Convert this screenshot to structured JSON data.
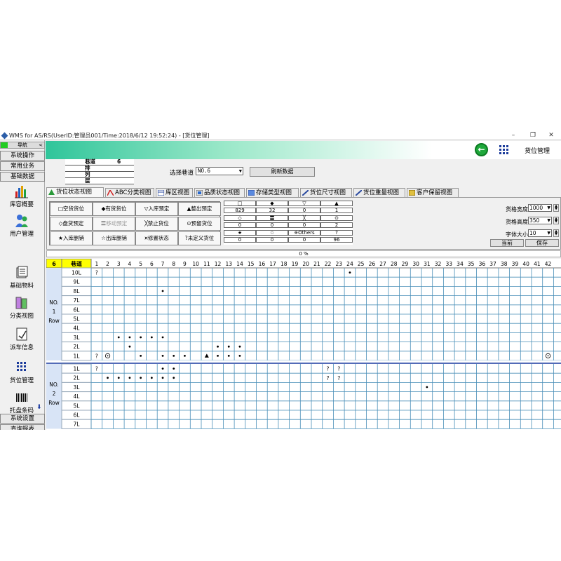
{
  "window": {
    "title": "WMS for AS/RS(UserID:管理员001/Time:2018/6/12 19:52:24) - [货位管理]",
    "min_label": "–",
    "max_label": "❐",
    "close_label": "✕"
  },
  "nav": {
    "header": "导航",
    "collapse": "<",
    "top_buttons": [
      "系统操作",
      "常用业务",
      "基础数据"
    ],
    "items": [
      {
        "label": "库容概要",
        "icon": "bar-chart-icon"
      },
      {
        "label": "用户管理",
        "icon": "users-icon"
      },
      {
        "label": "基础物料",
        "icon": "materials-icon"
      },
      {
        "label": "分类视图",
        "icon": "category-icon"
      },
      {
        "label": "派车信息",
        "icon": "dispatch-icon"
      },
      {
        "label": "货位管理",
        "icon": "grid-icon"
      },
      {
        "label": "托盘条码",
        "icon": "barcode-icon"
      }
    ],
    "bottom_buttons": [
      "系统设置",
      "查询报表"
    ]
  },
  "header": {
    "title": "货位管理",
    "back_icon": "back-arrow-icon",
    "menu_icon": "grid-menu-icon"
  },
  "info": {
    "rows": [
      {
        "key": "巷道",
        "value": "6"
      },
      {
        "key": "排",
        "value": ""
      },
      {
        "key": "列",
        "value": ""
      },
      {
        "key": "层",
        "value": ""
      }
    ]
  },
  "lane_select": {
    "label": "选择巷道",
    "value": "NO.6"
  },
  "refresh_label": "刷新数据",
  "tabs": [
    {
      "label": "货位状态视图",
      "active": true
    },
    {
      "label": "ABC分类视图"
    },
    {
      "label": "库区视图"
    },
    {
      "label": "品质状态视图"
    },
    {
      "label": "存储类型视图"
    },
    {
      "label": "货位尺寸视图"
    },
    {
      "label": "货位重量视图"
    },
    {
      "label": "客户保留视图"
    }
  ],
  "legend_status": [
    [
      "□空货货位",
      "◆有货货位",
      "▽入库预定",
      "▲整出预定"
    ],
    [
      "◇盘货预定",
      "〓移动预定",
      "╳禁止货位",
      "⊙预留货位"
    ],
    [
      "★入库删销",
      "☆出库删销",
      "¤修置状态",
      "?未定义货位"
    ]
  ],
  "legend_counts": [
    {
      "symbols": [
        "□",
        "◆",
        "▽",
        "▲"
      ],
      "counts": [
        "829",
        "32",
        "0",
        "1"
      ]
    },
    {
      "symbols": [
        "◇",
        "〓",
        "╳",
        "⊙"
      ],
      "counts": [
        "0",
        "0",
        "0",
        "2"
      ]
    },
    {
      "symbols": [
        "★",
        "☆",
        "※Others",
        "?"
      ],
      "counts": [
        "0",
        "0",
        "0",
        "96"
      ]
    }
  ],
  "settings": {
    "width_label": "货格宽度",
    "width_value": "1000",
    "height_label": "货格高度",
    "height_value": "350",
    "font_label": "字体大小",
    "font_value": "10",
    "current_label": "当前",
    "save_label": "保存"
  },
  "progress_text": "0 %",
  "grid": {
    "lane_no": "6",
    "header_label": "巷道",
    "columns": [
      "1",
      "2",
      "3",
      "4",
      "5",
      "6",
      "7",
      "8",
      "9",
      "10",
      "11",
      "12",
      "13",
      "14",
      "15",
      "16",
      "17",
      "18",
      "19",
      "20",
      "21",
      "22",
      "23",
      "24",
      "25",
      "26",
      "27",
      "28",
      "29",
      "30",
      "31",
      "32",
      "33",
      "34",
      "35",
      "36",
      "37",
      "38",
      "39",
      "40",
      "41",
      "42"
    ],
    "rows": [
      {
        "group": "NO.\n1\nRow",
        "levels": [
          "10L",
          "9L",
          "8L",
          "7L",
          "6L",
          "5L",
          "4L",
          "3L",
          "2L",
          "1L"
        ]
      },
      {
        "group": "NO.\n2\nRow",
        "levels": [
          "1L",
          "2L",
          "3L",
          "4L",
          "5L",
          "6L",
          "7L"
        ]
      }
    ],
    "marks": [
      {
        "row": 0,
        "level": 0,
        "col": 1,
        "sym": "?"
      },
      {
        "row": 0,
        "level": 0,
        "col": 24,
        "sym": "●"
      },
      {
        "row": 0,
        "level": 2,
        "col": 7,
        "sym": "●"
      },
      {
        "row": 0,
        "level": 7,
        "col": 3,
        "sym": "●"
      },
      {
        "row": 0,
        "level": 7,
        "col": 4,
        "sym": "●"
      },
      {
        "row": 0,
        "level": 7,
        "col": 5,
        "sym": "●"
      },
      {
        "row": 0,
        "level": 7,
        "col": 6,
        "sym": "●"
      },
      {
        "row": 0,
        "level": 7,
        "col": 7,
        "sym": "●"
      },
      {
        "row": 0,
        "level": 8,
        "col": 4,
        "sym": "●"
      },
      {
        "row": 0,
        "level": 8,
        "col": 12,
        "sym": "●"
      },
      {
        "row": 0,
        "level": 8,
        "col": 13,
        "sym": "●"
      },
      {
        "row": 0,
        "level": 8,
        "col": 14,
        "sym": "●"
      },
      {
        "row": 0,
        "level": 9,
        "col": 1,
        "sym": "?"
      },
      {
        "row": 0,
        "level": 9,
        "col": 2,
        "sym": "⊙"
      },
      {
        "row": 0,
        "level": 9,
        "col": 5,
        "sym": "●"
      },
      {
        "row": 0,
        "level": 9,
        "col": 7,
        "sym": "●"
      },
      {
        "row": 0,
        "level": 9,
        "col": 8,
        "sym": "●"
      },
      {
        "row": 0,
        "level": 9,
        "col": 9,
        "sym": "●"
      },
      {
        "row": 0,
        "level": 9,
        "col": 11,
        "sym": "▲"
      },
      {
        "row": 0,
        "level": 9,
        "col": 12,
        "sym": "●"
      },
      {
        "row": 0,
        "level": 9,
        "col": 13,
        "sym": "●"
      },
      {
        "row": 0,
        "level": 9,
        "col": 14,
        "sym": "●"
      },
      {
        "row": 0,
        "level": 9,
        "col": 42,
        "sym": "⊙"
      },
      {
        "row": 1,
        "level": 0,
        "col": 1,
        "sym": "?"
      },
      {
        "row": 1,
        "level": 0,
        "col": 7,
        "sym": "●"
      },
      {
        "row": 1,
        "level": 0,
        "col": 8,
        "sym": "●"
      },
      {
        "row": 1,
        "level": 0,
        "col": 22,
        "sym": "?"
      },
      {
        "row": 1,
        "level": 0,
        "col": 23,
        "sym": "?"
      },
      {
        "row": 1,
        "level": 1,
        "col": 2,
        "sym": "●"
      },
      {
        "row": 1,
        "level": 1,
        "col": 3,
        "sym": "●"
      },
      {
        "row": 1,
        "level": 1,
        "col": 4,
        "sym": "●"
      },
      {
        "row": 1,
        "level": 1,
        "col": 5,
        "sym": "●"
      },
      {
        "row": 1,
        "level": 1,
        "col": 6,
        "sym": "●"
      },
      {
        "row": 1,
        "level": 1,
        "col": 7,
        "sym": "●"
      },
      {
        "row": 1,
        "level": 1,
        "col": 8,
        "sym": "●"
      },
      {
        "row": 1,
        "level": 1,
        "col": 22,
        "sym": "?"
      },
      {
        "row": 1,
        "level": 1,
        "col": 23,
        "sym": "?"
      },
      {
        "row": 1,
        "level": 2,
        "col": 31,
        "sym": "●"
      }
    ]
  },
  "colors": {
    "grid_line": "#4a8fb8",
    "header_yellow": "#ffff00",
    "lane_bg": "#d8e4f6",
    "accent_green": "#1fa83b"
  }
}
